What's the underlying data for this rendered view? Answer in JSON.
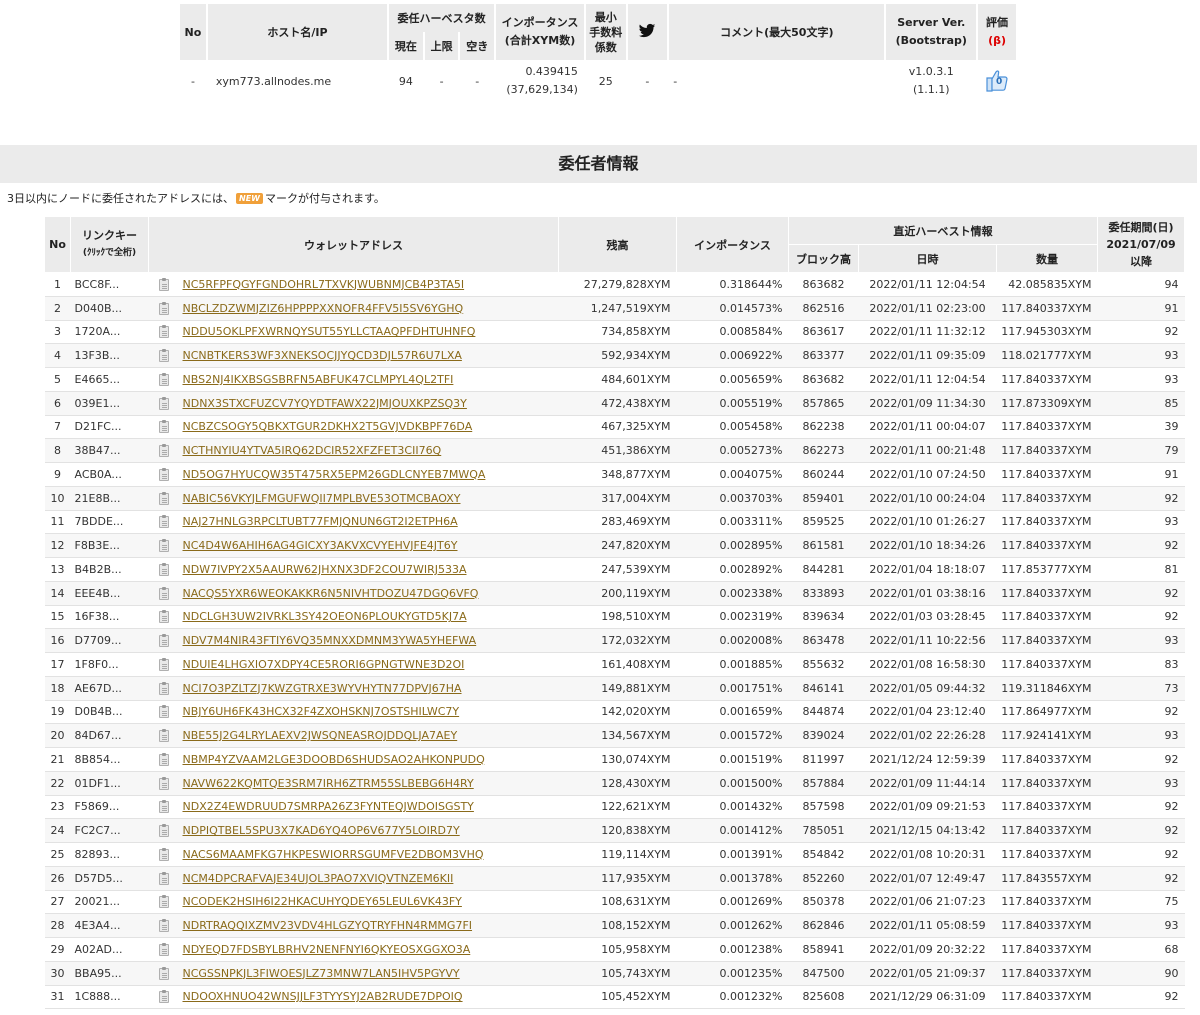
{
  "node_table": {
    "headers": {
      "no": "No",
      "host": "ホスト名/IP",
      "delegated_group": "委任ハーベスタ数",
      "current": "現在",
      "limit": "上限",
      "free": "空き",
      "importance_line1": "インポータンス",
      "importance_line2": "(合計XYM数)",
      "min_fee_line1": "最小",
      "min_fee_line2": "手数料",
      "min_fee_line3": "係数",
      "comment": "コメント(最大50文字)",
      "server_line1": "Server Ver.",
      "server_line2": "(Bootstrap)",
      "rating_line1": "評価",
      "rating_line2": "(β)"
    },
    "row": {
      "no": "-",
      "host": "xym773.allnodes.me",
      "current": "94",
      "limit": "-",
      "free": "-",
      "importance": "0.439415",
      "total_xym": "(37,629,134)",
      "min_fee": "25",
      "twitter": "-",
      "comment": "-",
      "server_ver": "v1.0.3.1",
      "bootstrap": "(1.1.1)",
      "rating_count": "0"
    },
    "icons": {
      "twitter": "twitter-bird-icon",
      "rating": "thumbs-up-icon"
    },
    "colors": {
      "twitter": "#111111",
      "thumb": "#4a90d9",
      "beta": "#dd0000"
    }
  },
  "section": {
    "title": "委任者情報",
    "notice_before": "3日以内にノードに委任されたアドレスには、",
    "new_badge": "NEW",
    "notice_after": "マークが付与されます。"
  },
  "delegators": {
    "headers": {
      "no": "No",
      "link_key": "リンクキー",
      "link_key_sub": "(ｸﾘｯｸで全桁)",
      "wallet": "ウォレットアドレス",
      "balance": "残高",
      "importance": "インポータンス",
      "recent_harvest": "直近ハーベスト情報",
      "block_height": "ブロック高",
      "datetime": "日時",
      "amount": "数量",
      "period_line1": "委任期間(日)",
      "period_line2": "2021/07/09",
      "period_line3": "以降"
    },
    "rows": [
      {
        "no": "1",
        "key": "BCC8F...",
        "addr": "NC5RFPFQGYFGNDOHRL7TXVKJWUBNMJCB4P3TA5I",
        "bal": "27,279,828XYM",
        "imp": "0.318644%",
        "block": "863682",
        "date": "2022/01/11 12:04:54",
        "amt": "42.085835XYM",
        "days": "94"
      },
      {
        "no": "2",
        "key": "D040B...",
        "addr": "NBCLZDZWMJZIZ6HPPPPXXNOFR4FFV5I5SV6YGHQ",
        "bal": "1,247,519XYM",
        "imp": "0.014573%",
        "block": "862516",
        "date": "2022/01/11 02:23:00",
        "amt": "117.840337XYM",
        "days": "91"
      },
      {
        "no": "3",
        "key": "1720A...",
        "addr": "NDDU5OKLPFXWRNQYSUT55YLLCTAAQPFDHTUHNFQ",
        "bal": "734,858XYM",
        "imp": "0.008584%",
        "block": "863617",
        "date": "2022/01/11 11:32:12",
        "amt": "117.945303XYM",
        "days": "92"
      },
      {
        "no": "4",
        "key": "13F3B...",
        "addr": "NCNBTKERS3WF3XNEKSOCJJYQCD3DJL57R6U7LXA",
        "bal": "592,934XYM",
        "imp": "0.006922%",
        "block": "863377",
        "date": "2022/01/11 09:35:09",
        "amt": "118.021777XYM",
        "days": "93"
      },
      {
        "no": "5",
        "key": "E4665...",
        "addr": "NBS2NJ4IKXBSGSBRFN5ABFUK47CLMPYL4QL2TFI",
        "bal": "484,601XYM",
        "imp": "0.005659%",
        "block": "863682",
        "date": "2022/01/11 12:04:54",
        "amt": "117.840337XYM",
        "days": "93"
      },
      {
        "no": "6",
        "key": "039E1...",
        "addr": "NDNX3STXCFUZCV7YQYDTFAWX22JMJOUXKPZSQ3Y",
        "bal": "472,438XYM",
        "imp": "0.005519%",
        "block": "857865",
        "date": "2022/01/09 11:34:30",
        "amt": "117.873309XYM",
        "days": "85"
      },
      {
        "no": "7",
        "key": "D21FC...",
        "addr": "NCBZCSOGY5QBKXTGUR2DKHX2T5GVJVDKBPF76DA",
        "bal": "467,325XYM",
        "imp": "0.005458%",
        "block": "862238",
        "date": "2022/01/11 00:04:07",
        "amt": "117.840337XYM",
        "days": "39"
      },
      {
        "no": "8",
        "key": "38B47...",
        "addr": "NCTHNYIU4YTVA5IRQ62DCIR52XFZFET3CII76Q",
        "bal": "451,386XYM",
        "imp": "0.005273%",
        "block": "862273",
        "date": "2022/01/11 00:21:48",
        "amt": "117.840337XYM",
        "days": "79"
      },
      {
        "no": "9",
        "key": "ACB0A...",
        "addr": "ND5OG7HYUCQW35T475RX5EPM26GDLCNYEB7MWQA",
        "bal": "348,877XYM",
        "imp": "0.004075%",
        "block": "860244",
        "date": "2022/01/10 07:24:50",
        "amt": "117.840337XYM",
        "days": "91"
      },
      {
        "no": "10",
        "key": "21E8B...",
        "addr": "NABIC56VKYJLFMGUFWQII7MPLBVE53OTMCBAOXY",
        "bal": "317,004XYM",
        "imp": "0.003703%",
        "block": "859401",
        "date": "2022/01/10 00:24:04",
        "amt": "117.840337XYM",
        "days": "92"
      },
      {
        "no": "11",
        "key": "7BDDE...",
        "addr": "NAJ27HNLG3RPCLTUBT77FMJQNUN6GT2I2ETPH6A",
        "bal": "283,469XYM",
        "imp": "0.003311%",
        "block": "859525",
        "date": "2022/01/10 01:26:27",
        "amt": "117.840337XYM",
        "days": "93"
      },
      {
        "no": "12",
        "key": "F8B3E...",
        "addr": "NC4D4W6AHIH6AG4GICXY3AKVXCVYEHVJFE4JT6Y",
        "bal": "247,820XYM",
        "imp": "0.002895%",
        "block": "861581",
        "date": "2022/01/10 18:34:26",
        "amt": "117.840337XYM",
        "days": "92"
      },
      {
        "no": "13",
        "key": "B4B2B...",
        "addr": "NDW7IVPY2X5AAURW62JHXNX3DF2COU7WIRJ533A",
        "bal": "247,539XYM",
        "imp": "0.002892%",
        "block": "844281",
        "date": "2022/01/04 18:18:07",
        "amt": "117.853777XYM",
        "days": "81"
      },
      {
        "no": "14",
        "key": "EEE4B...",
        "addr": "NACQS5YXR6WEOKAKKR6N5NIVHTDOZU47DGQ6VFQ",
        "bal": "200,119XYM",
        "imp": "0.002338%",
        "block": "833893",
        "date": "2022/01/01 03:38:16",
        "amt": "117.840337XYM",
        "days": "92"
      },
      {
        "no": "15",
        "key": "16F38...",
        "addr": "NDCLGH3UW2IVRKL3SY42OEON6PLOUKYGTD5KJ7A",
        "bal": "198,510XYM",
        "imp": "0.002319%",
        "block": "839634",
        "date": "2022/01/03 03:28:45",
        "amt": "117.840337XYM",
        "days": "92"
      },
      {
        "no": "16",
        "key": "D7709...",
        "addr": "NDV7M4NIR43FTIY6VQ35MNXXDMNM3YWA5YHEFWA",
        "bal": "172,032XYM",
        "imp": "0.002008%",
        "block": "863478",
        "date": "2022/01/11 10:22:56",
        "amt": "117.840337XYM",
        "days": "93"
      },
      {
        "no": "17",
        "key": "1F8F0...",
        "addr": "NDUIE4LHGXIO7XDPY4CE5RORI6GPNGTWNE3D2OI",
        "bal": "161,408XYM",
        "imp": "0.001885%",
        "block": "855632",
        "date": "2022/01/08 16:58:30",
        "amt": "117.840337XYM",
        "days": "83"
      },
      {
        "no": "18",
        "key": "AE67D...",
        "addr": "NCI7O3PZLTZJ7KWZGTRXE3WYVHYTN77DPVJ67HA",
        "bal": "149,881XYM",
        "imp": "0.001751%",
        "block": "846141",
        "date": "2022/01/05 09:44:32",
        "amt": "119.311846XYM",
        "days": "73"
      },
      {
        "no": "19",
        "key": "D0B4B...",
        "addr": "NBJY6UH6FK43HCX32F4ZXOHSKNJ7OSTSHILWC7Y",
        "bal": "142,020XYM",
        "imp": "0.001659%",
        "block": "844874",
        "date": "2022/01/04 23:12:40",
        "amt": "117.864977XYM",
        "days": "92"
      },
      {
        "no": "20",
        "key": "84D67...",
        "addr": "NBE55J2G4LRYLAEXV2JWSQNEASROJDDQLJA7AEY",
        "bal": "134,567XYM",
        "imp": "0.001572%",
        "block": "839024",
        "date": "2022/01/02 22:26:28",
        "amt": "117.924141XYM",
        "days": "93"
      },
      {
        "no": "21",
        "key": "8B854...",
        "addr": "NBMP4YZVAAM2LGE3DOOBD6SHUDSAO2AHKONPUDQ",
        "bal": "130,074XYM",
        "imp": "0.001519%",
        "block": "811997",
        "date": "2021/12/24 12:59:39",
        "amt": "117.840337XYM",
        "days": "92"
      },
      {
        "no": "22",
        "key": "01DF1...",
        "addr": "NAVW622KQMTQE3SRM7IRH6ZTRM55SLBEBG6H4RY",
        "bal": "128,430XYM",
        "imp": "0.001500%",
        "block": "857884",
        "date": "2022/01/09 11:44:14",
        "amt": "117.840337XYM",
        "days": "93"
      },
      {
        "no": "23",
        "key": "F5869...",
        "addr": "NDX2Z4EWDRUUD7SMRPA26Z3FYNTEQJWDOISGSTY",
        "bal": "122,621XYM",
        "imp": "0.001432%",
        "block": "857598",
        "date": "2022/01/09 09:21:53",
        "amt": "117.840337XYM",
        "days": "92"
      },
      {
        "no": "24",
        "key": "FC2C7...",
        "addr": "NDPIQTBEL5SPU3X7KAD6YQ4OP6V677Y5LOIRD7Y",
        "bal": "120,838XYM",
        "imp": "0.001412%",
        "block": "785051",
        "date": "2021/12/15 04:13:42",
        "amt": "117.840337XYM",
        "days": "92"
      },
      {
        "no": "25",
        "key": "82893...",
        "addr": "NACS6MAAMFKG7HKPESWIORRSGUMFVE2DBOM3VHQ",
        "bal": "119,114XYM",
        "imp": "0.001391%",
        "block": "854842",
        "date": "2022/01/08 10:20:31",
        "amt": "117.840337XYM",
        "days": "92"
      },
      {
        "no": "26",
        "key": "D57D5...",
        "addr": "NCM4DPCRAFVAJE34UJOL3PAO7XVIQVTNZEM6KII",
        "bal": "117,935XYM",
        "imp": "0.001378%",
        "block": "852260",
        "date": "2022/01/07 12:49:47",
        "amt": "117.843557XYM",
        "days": "92"
      },
      {
        "no": "27",
        "key": "20021...",
        "addr": "NCODEK2HSIH6I22HKACUHYQDEY65LEUL6VK43FY",
        "bal": "108,631XYM",
        "imp": "0.001269%",
        "block": "850378",
        "date": "2022/01/06 21:07:23",
        "amt": "117.840337XYM",
        "days": "75"
      },
      {
        "no": "28",
        "key": "4E3A4...",
        "addr": "NDRTRAQQIXZMV23VDV4HLGZYQTRYFHN4RMMG7FI",
        "bal": "108,152XYM",
        "imp": "0.001262%",
        "block": "862846",
        "date": "2022/01/11 05:08:59",
        "amt": "117.840337XYM",
        "days": "93"
      },
      {
        "no": "29",
        "key": "A02AD...",
        "addr": "NDYEQD7FDSBYLBRHV2NENFNYI6QKYEOSXGGXO3A",
        "bal": "105,958XYM",
        "imp": "0.001238%",
        "block": "858941",
        "date": "2022/01/09 20:32:22",
        "amt": "117.840337XYM",
        "days": "68"
      },
      {
        "no": "30",
        "key": "BBA95...",
        "addr": "NCGSSNPKJL3FIWOESJLZ73MNW7LAN5IHV5PGYVY",
        "bal": "105,743XYM",
        "imp": "0.001235%",
        "block": "847500",
        "date": "2022/01/05 21:09:37",
        "amt": "117.840337XYM",
        "days": "90"
      },
      {
        "no": "31",
        "key": "1C888...",
        "addr": "NDOOXHNUO42WNSJJLF3TYYSYJ2AB2RUDE7DPOIQ",
        "bal": "105,452XYM",
        "imp": "0.001232%",
        "block": "825608",
        "date": "2021/12/29 06:31:09",
        "amt": "117.840337XYM",
        "days": "92"
      }
    ]
  }
}
